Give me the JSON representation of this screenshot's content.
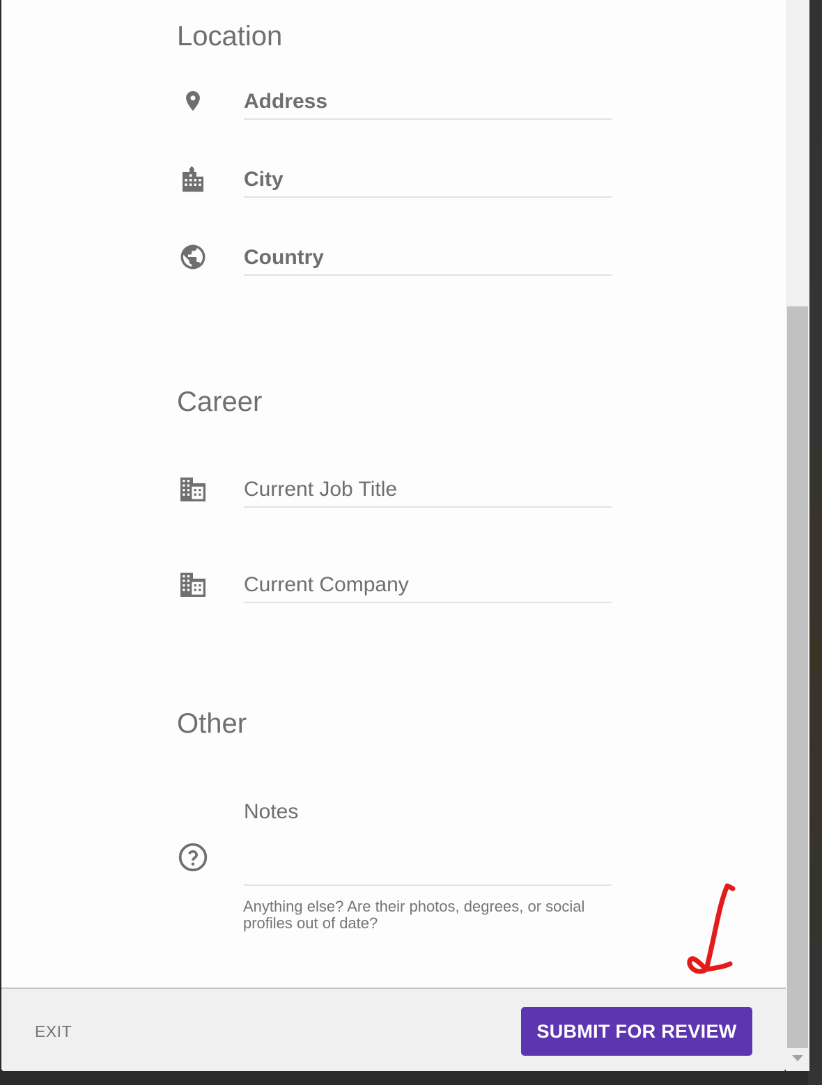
{
  "sections": {
    "location": {
      "title": "Location",
      "fields": [
        {
          "label": "Address",
          "icon": "location-pin-icon"
        },
        {
          "label": "City",
          "icon": "city-icon"
        },
        {
          "label": "Country",
          "icon": "globe-icon"
        }
      ]
    },
    "career": {
      "title": "Career",
      "fields": [
        {
          "label": "Current Job Title",
          "icon": "business-icon"
        },
        {
          "label": "Current Company",
          "icon": "business-icon"
        }
      ]
    },
    "other": {
      "title": "Other",
      "fields": [
        {
          "label": "Notes",
          "icon": "help-circle-icon",
          "helper": "Anything else? Are their photos, degrees, or social profiles out of date?"
        }
      ]
    }
  },
  "footer": {
    "exit_label": "EXIT",
    "submit_label": "SUBMIT FOR REVIEW"
  },
  "colors": {
    "accent": "#5e35b1",
    "annotation": "#e31b1b"
  }
}
